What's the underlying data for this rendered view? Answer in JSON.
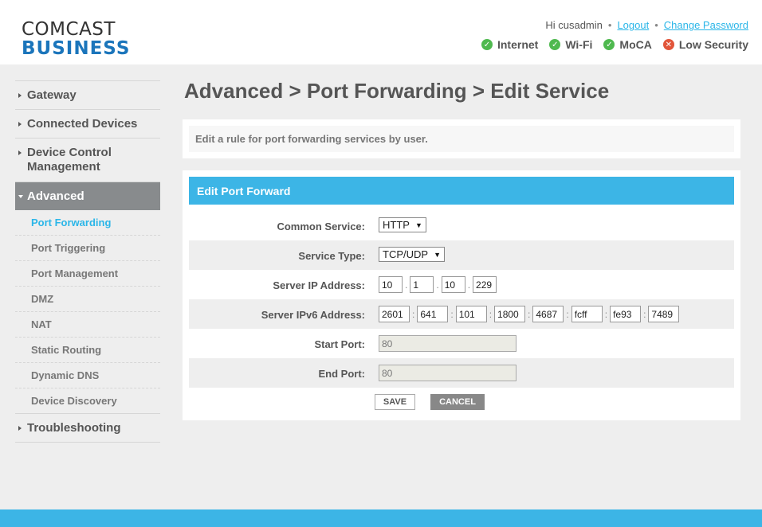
{
  "header": {
    "logo_line1": "COMCAST",
    "logo_line2": "BUSINESS",
    "greeting": "Hi cusadmin",
    "logout": "Logout",
    "change_password": "Change Password",
    "status": [
      {
        "label": "Internet",
        "state": "ok",
        "icon": "check-icon"
      },
      {
        "label": "Wi-Fi",
        "state": "ok",
        "icon": "check-icon"
      },
      {
        "label": "MoCA",
        "state": "ok",
        "icon": "check-icon"
      },
      {
        "label": "Low Security",
        "state": "bad",
        "icon": "x-icon"
      }
    ]
  },
  "sidebar": {
    "gateway": "Gateway",
    "connected_devices": "Connected Devices",
    "device_control_1": "Device Control",
    "device_control_2": "Management",
    "advanced": "Advanced",
    "sub": [
      "Port Forwarding",
      "Port Triggering",
      "Port Management",
      "DMZ",
      "NAT",
      "Static Routing",
      "Dynamic DNS",
      "Device Discovery"
    ],
    "troubleshooting": "Troubleshooting"
  },
  "page": {
    "title": "Advanced > Port Forwarding > Edit Service",
    "description": "Edit a rule for port forwarding services by user."
  },
  "form": {
    "heading": "Edit Port Forward",
    "common_service_label": "Common Service:",
    "common_service_value": "HTTP",
    "service_type_label": "Service Type:",
    "service_type_value": "TCP/UDP",
    "server_ip_label": "Server IP Address:",
    "server_ip": [
      "10",
      "1",
      "10",
      "229"
    ],
    "server_ipv6_label": "Server IPv6 Address:",
    "server_ipv6": [
      "2601",
      "641",
      "101",
      "1800",
      "4687",
      "fcff",
      "fe93",
      "7489"
    ],
    "start_port_label": "Start Port:",
    "start_port_value": "80",
    "end_port_label": "End Port:",
    "end_port_value": "80",
    "save_label": "SAVE",
    "cancel_label": "CANCEL"
  },
  "colors": {
    "accent": "#3cb5e6",
    "brand_blue": "#1b75bb",
    "ok": "#4fb94f",
    "bad": "#e2553a"
  }
}
